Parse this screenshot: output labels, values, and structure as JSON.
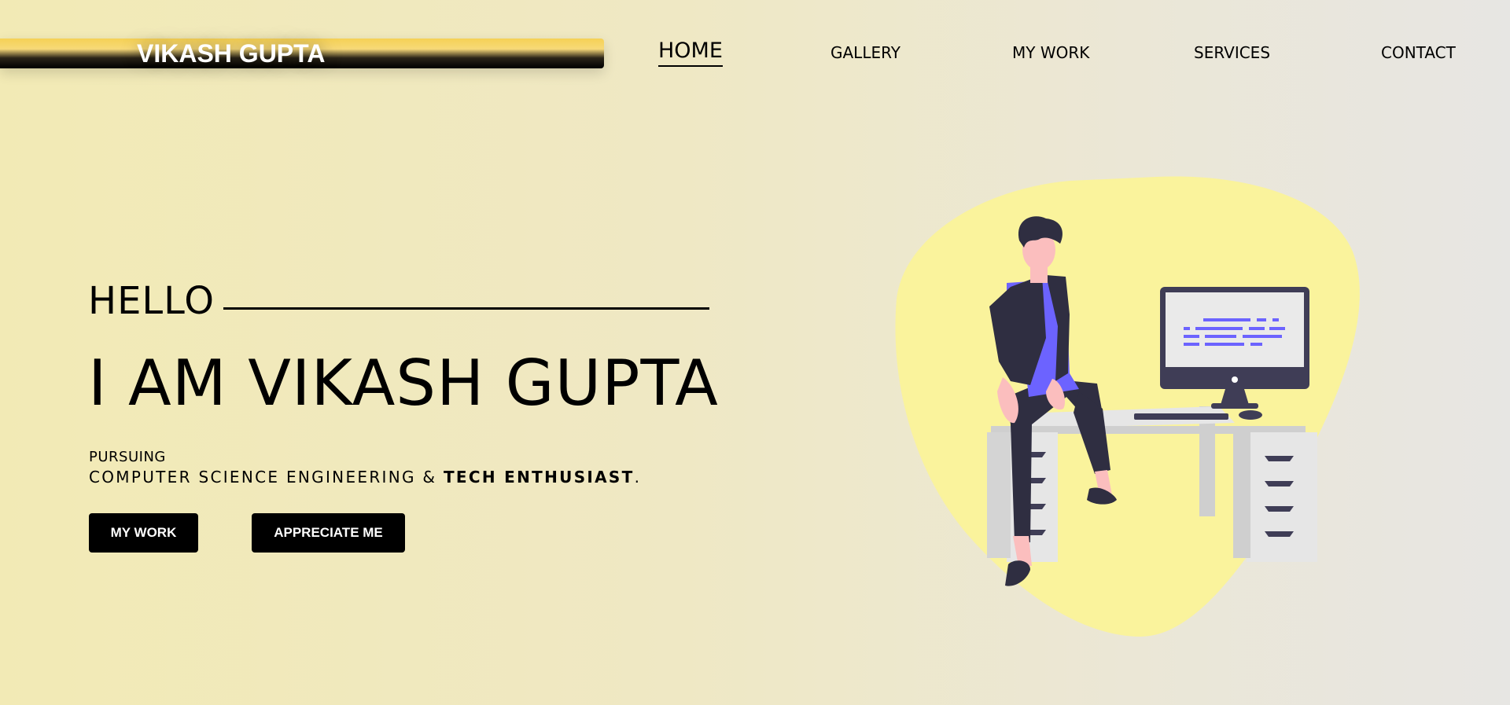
{
  "header": {
    "brand": "VIKASH GUPTA",
    "nav": [
      {
        "label": "HOME",
        "active": true
      },
      {
        "label": "GALLERY",
        "active": false
      },
      {
        "label": "MY WORK",
        "active": false
      },
      {
        "label": "SERVICES",
        "active": false
      },
      {
        "label": "CONTACT",
        "active": false
      }
    ]
  },
  "hero": {
    "hello": "HELLO",
    "title": "I AM VIKASH GUPTA",
    "pursuing": "PURSUING",
    "subtitle_main": "COMPUTER SCIENCE ENGINEERING & ",
    "subtitle_strong": "TECH ENTHUSIAST",
    "subtitle_end": ".",
    "buttons": {
      "my_work": "MY WORK",
      "appreciate": "APPRECIATE ME"
    }
  },
  "illustration": {
    "icon": "person-at-desk-illustration",
    "colors": {
      "blob": "#faf39c",
      "accent": "#6c63ff",
      "dark": "#2f2e41",
      "skin": "#fbbebe",
      "desk": "#e6e6e6"
    }
  },
  "colors": {
    "brand_gold": "#f5d155",
    "text": "#000000",
    "button_bg": "#000000",
    "button_text": "#ffffff"
  }
}
